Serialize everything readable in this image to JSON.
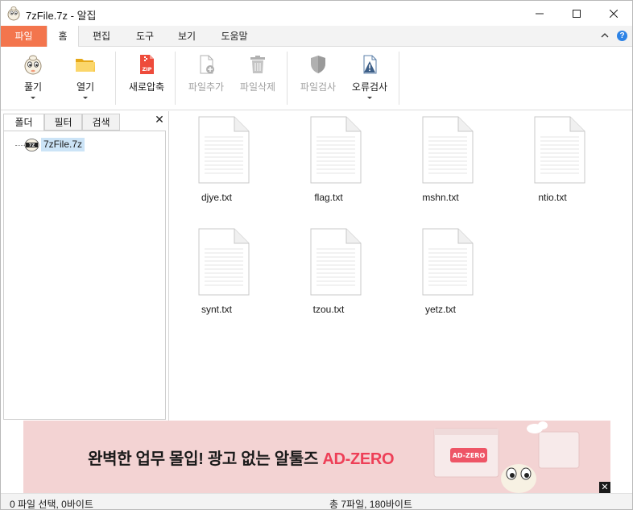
{
  "window": {
    "title": "7zFile.7z - 알집"
  },
  "ribbon_tabs": {
    "file": "파일",
    "home": "홈",
    "edit": "편집",
    "tools": "도구",
    "view": "보기",
    "help": "도움말"
  },
  "help_glyph": "?",
  "ribbon": {
    "unzip": "풀기",
    "open": "열기",
    "new_archive": "새로압축",
    "add_file": "파일추가",
    "delete_file": "파일삭제",
    "scan_file": "파일검사",
    "error_check": "오류검사"
  },
  "left_panel": {
    "tabs": {
      "folder": "폴더",
      "filter": "필터",
      "search": "검색"
    },
    "close_glyph": "✕",
    "tree_root": "7zFile.7z"
  },
  "files": [
    {
      "name": "djye.txt"
    },
    {
      "name": "flag.txt"
    },
    {
      "name": "mshn.txt"
    },
    {
      "name": "ntio.txt"
    },
    {
      "name": "synt.txt"
    },
    {
      "name": "tzou.txt"
    },
    {
      "name": "yetz.txt"
    }
  ],
  "ad": {
    "text": "완벽한 업무 몰입! 광고 없는 알툴즈 ",
    "brand": "AD-ZERO",
    "badge": "AD-ZERO",
    "close_glyph": "✕"
  },
  "status": {
    "left": "0 파일 선택,  0바이트",
    "right": "총 7파일,  180바이트"
  },
  "colors": {
    "file_tab": "#f3754d",
    "ad_background": "#f3d3d3",
    "ad_brand": "#ee3f57",
    "selection": "#cce4f7"
  }
}
